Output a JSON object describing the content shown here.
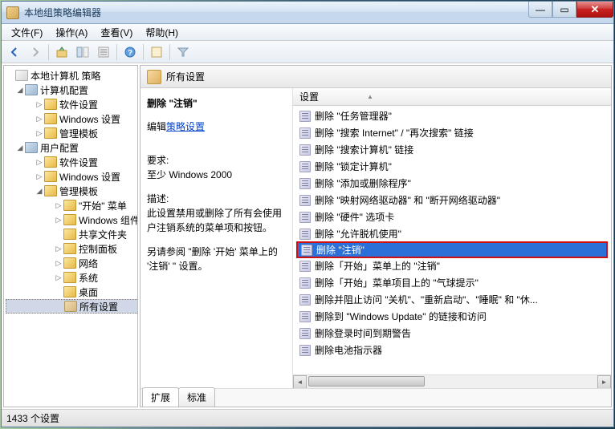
{
  "titlebar": {
    "title": "本地组策略编辑器"
  },
  "menubar": {
    "file": "文件(F)",
    "action": "操作(A)",
    "view": "查看(V)",
    "help": "帮助(H)"
  },
  "tree": {
    "root": "本地计算机 策略",
    "computer": "计算机配置",
    "computer_children": [
      "软件设置",
      "Windows 设置",
      "管理模板"
    ],
    "user": "用户配置",
    "user_children": {
      "software": "软件设置",
      "windows": "Windows 设置",
      "admin": "管理模板",
      "admin_children": {
        "start_menu": "\"开始\" 菜单",
        "windows_comp": "Windows 组件",
        "shared": "共享文件夹",
        "control": "控制面板",
        "network": "网络",
        "system": "系统",
        "desktop": "桌面",
        "all_settings": "所有设置"
      }
    }
  },
  "header": {
    "title": "所有设置"
  },
  "description": {
    "title": "删除 \"注销\"",
    "edit_prefix": "编辑",
    "edit_link": "策略设置",
    "req_label": "要求:",
    "req_text": "至少 Windows 2000",
    "desc_label": "描述:",
    "desc_text": "此设置禁用或删除了所有会使用户注销系统的菜单项和按钮。",
    "see_also": "另请参阅 \"删除 '开始' 菜单上的 '注销' \" 设置。"
  },
  "list": {
    "header": "设置",
    "items": [
      "删除 \"任务管理器\"",
      "删除 \"搜索 Internet\" / \"再次搜索\" 链接",
      "删除 \"搜索计算机\" 链接",
      "删除 \"锁定计算机\"",
      "删除 \"添加或删除程序\"",
      "删除 \"映射网络驱动器\" 和 \"断开网络驱动器\"",
      "删除 \"硬件\" 选项卡",
      "删除 \"允许脱机使用\"",
      "删除 \"注销\"",
      "删除「开始」菜单上的 \"注销\"",
      "删除「开始」菜单项目上的 \"气球提示\"",
      "删除并阻止访问 \"关机\"、\"重新启动\"、\"睡眠\" 和 \"休...",
      "删除到 \"Windows Update\" 的链接和访问",
      "删除登录时间到期警告",
      "删除电池指示器"
    ],
    "selected_index": 8
  },
  "tabs": {
    "ext": "扩展",
    "std": "标准"
  },
  "statusbar": {
    "text": "1433 个设置"
  }
}
